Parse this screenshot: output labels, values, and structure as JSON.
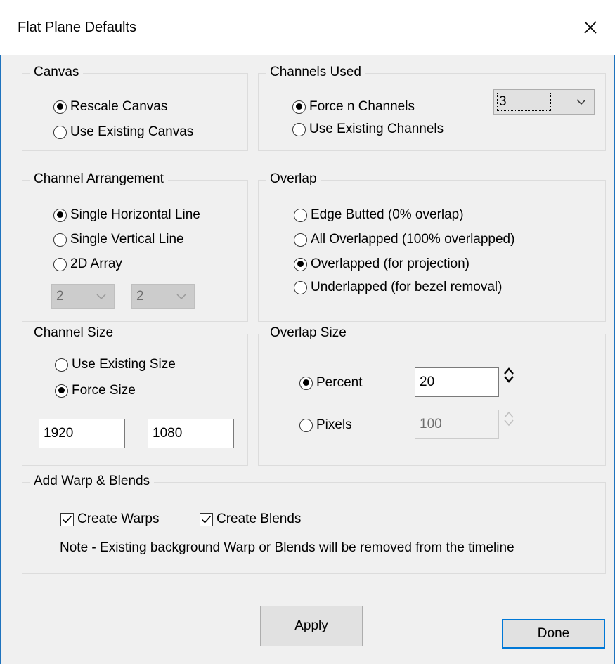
{
  "window": {
    "title": "Flat Plane Defaults",
    "close_icon": "close-icon"
  },
  "canvas": {
    "legend": "Canvas",
    "options": [
      "Rescale Canvas",
      "Use Existing Canvas"
    ],
    "selected": 0
  },
  "channels_used": {
    "legend": "Channels Used",
    "options": [
      "Force n Channels",
      "Use Existing Channels"
    ],
    "selected": 0,
    "count": "3"
  },
  "channel_arrangement": {
    "legend": "Channel Arrangement",
    "options": [
      "Single Horizontal Line",
      "Single Vertical Line",
      "2D Array"
    ],
    "selected": 0,
    "array_cols": "2",
    "array_rows": "2"
  },
  "overlap": {
    "legend": "Overlap",
    "options": [
      "Edge Butted (0% overlap)",
      "All Overlapped (100% overlapped)",
      "Overlapped (for projection)",
      "Underlapped (for bezel removal)"
    ],
    "selected": 2
  },
  "channel_size": {
    "legend": "Channel Size",
    "options": [
      "Use Existing Size",
      "Force Size"
    ],
    "selected": 1,
    "width": "1920",
    "height": "1080"
  },
  "overlap_size": {
    "legend": "Overlap Size",
    "percent_label": "Percent",
    "percent_value": "20",
    "pixels_label": "Pixels",
    "pixels_value": "100",
    "selected": "percent"
  },
  "warp_blends": {
    "legend": "Add Warp & Blends",
    "create_warps_label": "Create Warps",
    "create_warps_checked": true,
    "create_blends_label": "Create Blends",
    "create_blends_checked": true,
    "note": "Note - Existing background Warp or Blends will be removed from the timeline"
  },
  "buttons": {
    "apply": "Apply",
    "done": "Done"
  },
  "colors": {
    "accent": "#0078d7",
    "window_border": "#1e73be",
    "background": "#f0f0f0"
  }
}
